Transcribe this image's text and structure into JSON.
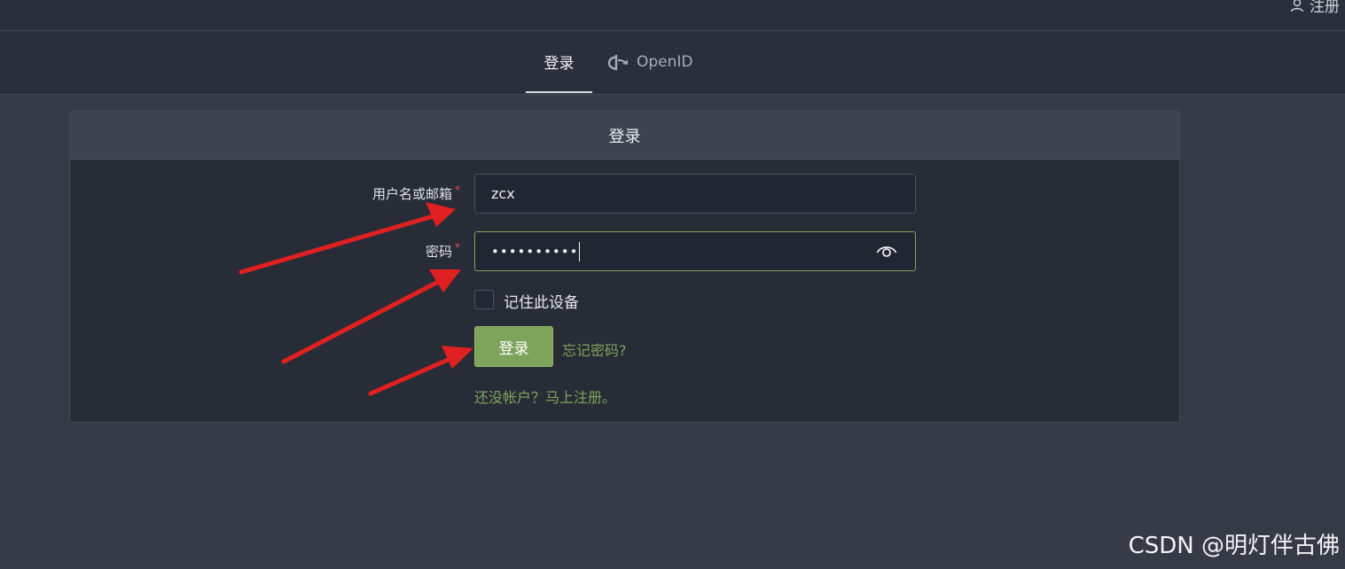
{
  "top_bar": {
    "register_label": "注册"
  },
  "tabs": [
    {
      "label": "登录",
      "active": true
    },
    {
      "label": "OpenID",
      "icon": "openid-icon",
      "active": false
    }
  ],
  "card": {
    "title": "登录"
  },
  "form": {
    "username_label": "用户名或邮箱",
    "username_value": "zcx",
    "password_label": "密码",
    "password_masked": "••••••••••",
    "required_mark": "*",
    "remember_label": "记住此设备",
    "remember_checked": false,
    "login_button": "登录",
    "forgot_link": "忘记密码?",
    "register_link": "还没帐户？马上注册。"
  },
  "watermark": "CSDN @明灯伴古佛",
  "colors": {
    "accent": "#7ea35a",
    "arrow": "#e02020",
    "required": "#e0484a"
  }
}
